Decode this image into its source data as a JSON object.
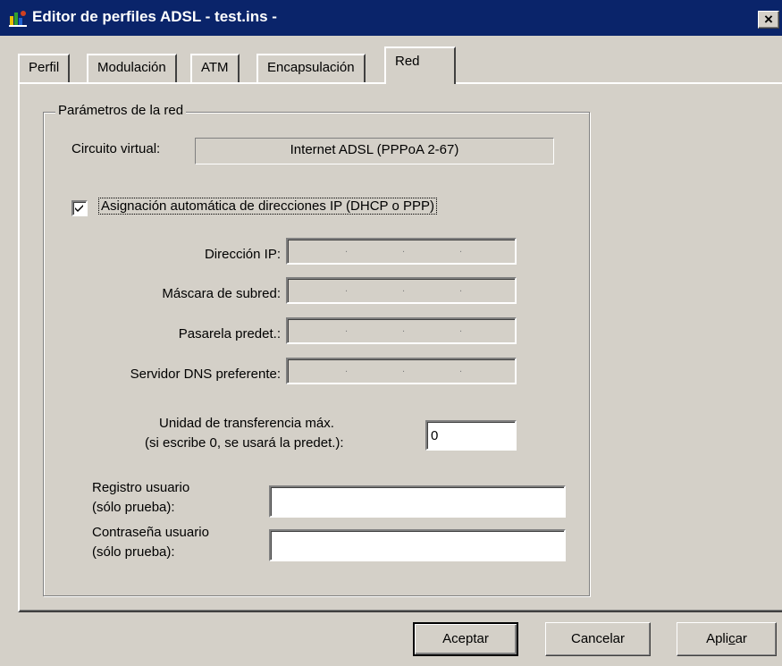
{
  "window": {
    "title": "Editor de perfiles ADSL - test.ins -",
    "close_glyph": "×",
    "icon": "app-icon"
  },
  "tabs": [
    {
      "label": "Perfil",
      "active": false
    },
    {
      "label": "Modulación",
      "active": false
    },
    {
      "label": "ATM",
      "active": false
    },
    {
      "label": "Encapsulación",
      "active": false
    },
    {
      "label": "Red",
      "active": true
    }
  ],
  "group": {
    "legend": "Parámetros de la red"
  },
  "circuit": {
    "label": "Circuito virtual:",
    "value": "Internet ADSL (PPPoA 2-67)"
  },
  "auto_ip": {
    "label": "Asignación automática de direcciones IP (DHCP o PPP)",
    "checked": true,
    "check_glyph": "✓"
  },
  "ip_fields": [
    {
      "label": "Dirección IP:"
    },
    {
      "label": "Máscara de subred:"
    },
    {
      "label": "Pasarela predet.:"
    },
    {
      "label": "Servidor DNS preferente:"
    }
  ],
  "mtu": {
    "label_line1": "Unidad de transferencia máx.",
    "label_line2": "(si escribe 0, se usará la predet.):",
    "value": "0"
  },
  "user_login": {
    "label_line1": "Registro usuario",
    "label_line2": "(sólo prueba):",
    "value": ""
  },
  "user_password": {
    "label_line1": "Contraseña usuario",
    "label_line2": "(sólo prueba):",
    "value": ""
  },
  "buttons": {
    "ok": "Aceptar",
    "cancel": "Cancelar",
    "apply_pre": "Apli",
    "apply_underline": "c",
    "apply_post": "ar"
  },
  "colors": {
    "face": "#d4d0c8",
    "title_bar": "#0a246a"
  }
}
